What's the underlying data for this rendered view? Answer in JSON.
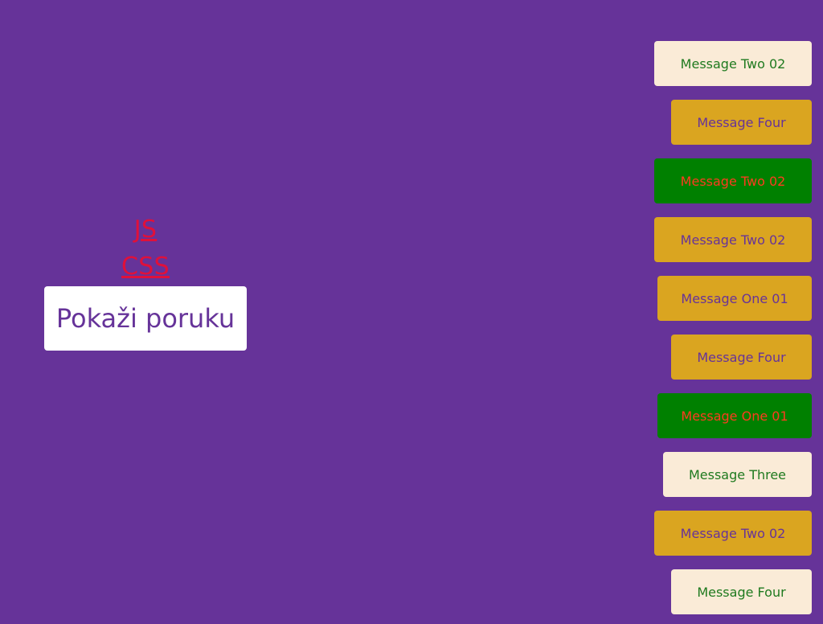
{
  "links": {
    "js": "JS",
    "css": "CSS"
  },
  "main_button": {
    "label": "Pokaži poruku"
  },
  "colors": {
    "background": "#663399",
    "link": "#e0103a",
    "cream": "#faebd7",
    "gold": "#daa520",
    "green": "#008000"
  },
  "messages": [
    {
      "text": "Message Two 02",
      "variant": "cream"
    },
    {
      "text": "Message Four",
      "variant": "gold"
    },
    {
      "text": "Message Two 02",
      "variant": "green"
    },
    {
      "text": "Message Two 02",
      "variant": "gold"
    },
    {
      "text": "Message One 01",
      "variant": "gold"
    },
    {
      "text": "Message Four",
      "variant": "gold"
    },
    {
      "text": "Message One 01",
      "variant": "green"
    },
    {
      "text": "Message Three",
      "variant": "cream"
    },
    {
      "text": "Message Two 02",
      "variant": "gold"
    },
    {
      "text": "Message Four",
      "variant": "cream"
    }
  ]
}
